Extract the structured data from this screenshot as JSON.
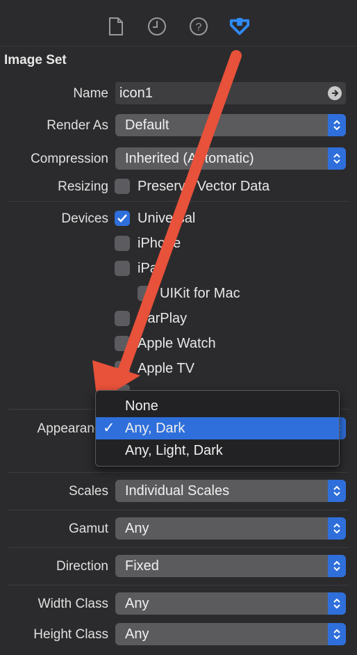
{
  "toolbar": {
    "icons": [
      "file-inspector-icon",
      "history-inspector-icon",
      "quick-help-icon",
      "attributes-inspector-icon"
    ]
  },
  "section": {
    "title": "Image Set"
  },
  "name_field": {
    "label": "Name",
    "value": "icon1"
  },
  "render_as": {
    "label": "Render As",
    "value": "Default"
  },
  "compression": {
    "label": "Compression",
    "value": "Inherited (Automatic)"
  },
  "resizing": {
    "label": "Resizing",
    "checkbox": "Preserve Vector Data",
    "checked": false
  },
  "devices": {
    "label": "Devices",
    "items": [
      {
        "label": "Universal",
        "checked": true
      },
      {
        "label": "iPhone",
        "checked": false
      },
      {
        "label": "iPad",
        "checked": false
      },
      {
        "label": "UIKit for Mac",
        "checked": false
      },
      {
        "label": "CarPlay",
        "checked": false
      },
      {
        "label": "Apple Watch",
        "checked": false
      },
      {
        "label": "Apple TV",
        "checked": false
      }
    ]
  },
  "appearance": {
    "label": "Appearance",
    "menu": [
      {
        "label": "None",
        "selected": false
      },
      {
        "label": "Any, Dark",
        "selected": true
      },
      {
        "label": "Any, Light, Dark",
        "selected": false
      }
    ]
  },
  "scales": {
    "label": "Scales",
    "value": "Individual Scales"
  },
  "gamut": {
    "label": "Gamut",
    "value": "Any"
  },
  "direction": {
    "label": "Direction",
    "value": "Fixed"
  },
  "width_class": {
    "label": "Width Class",
    "value": "Any"
  },
  "height_class": {
    "label": "Height Class",
    "value": "Any"
  },
  "colors": {
    "accent": "#2f6fdb",
    "annotation_arrow": "#e8513a",
    "background": "#2b2b2d"
  }
}
